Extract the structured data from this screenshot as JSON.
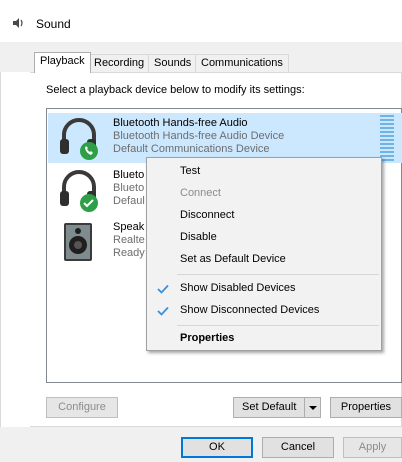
{
  "window": {
    "title": "Sound",
    "icon": "speaker-icon"
  },
  "tabs": [
    {
      "label": "Playback",
      "active": true
    },
    {
      "label": "Recording",
      "active": false
    },
    {
      "label": "Sounds",
      "active": false
    },
    {
      "label": "Communications",
      "active": false
    }
  ],
  "instruction": "Select a playback device below to modify its settings:",
  "devices": [
    {
      "name": "Bluetooth Hands-free Audio",
      "line1": "Bluetooth Hands-free Audio Device",
      "line2": "Default Communications Device",
      "icon": "headset-phone-icon",
      "selected": true
    },
    {
      "name": "Blueto",
      "line1": "Blueto",
      "line2": "Defaul",
      "icon": "headset-check-icon",
      "selected": false
    },
    {
      "name": "Speak",
      "line1": "Realte",
      "line2": "Ready",
      "icon": "speaker-box-icon",
      "selected": false
    }
  ],
  "context_menu": {
    "items": [
      {
        "label": "Test",
        "enabled": true,
        "checked": false,
        "bold": false
      },
      {
        "label": "Connect",
        "enabled": false,
        "checked": false,
        "bold": false
      },
      {
        "label": "Disconnect",
        "enabled": true,
        "checked": false,
        "bold": false
      },
      {
        "label": "Disable",
        "enabled": true,
        "checked": false,
        "bold": false
      },
      {
        "label": "Set as Default Device",
        "enabled": true,
        "checked": false,
        "bold": false
      },
      {
        "label": "Show Disabled Devices",
        "enabled": true,
        "checked": true,
        "bold": false
      },
      {
        "label": "Show Disconnected Devices",
        "enabled": true,
        "checked": true,
        "bold": false
      },
      {
        "label": "Properties",
        "enabled": true,
        "checked": false,
        "bold": true
      }
    ]
  },
  "buttons": {
    "configure": "Configure",
    "set_default": "Set Default",
    "properties": "Properties",
    "ok": "OK",
    "cancel": "Cancel",
    "apply": "Apply"
  },
  "colors": {
    "selection": "#cce8ff",
    "accent": "#0078d7",
    "check": "#3c8fdc"
  }
}
